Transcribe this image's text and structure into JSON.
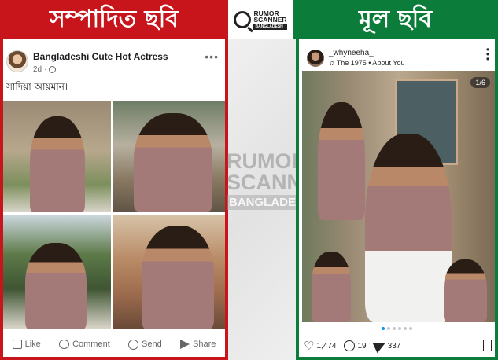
{
  "header": {
    "left_title": "সম্পাদিত ছবি",
    "right_title": "মূল ছবি",
    "logo_line1": "RUMOR",
    "logo_line2": "SCANNER",
    "logo_line3": "BANGLADESH"
  },
  "watermark": {
    "line1": "RUMOR",
    "line2": "SCANNER",
    "line3": "BANGLADESH"
  },
  "facebook_post": {
    "page_name": "Bangladeshi Cute Hot Actress",
    "time": "2d",
    "visibility_icon": "globe-icon",
    "caption": "সাদিয়া আয়মান।",
    "more_icon": "more-options-icon",
    "actions": [
      {
        "label": "Like",
        "icon": "like-icon"
      },
      {
        "label": "Comment",
        "icon": "comment-icon"
      },
      {
        "label": "Send",
        "icon": "send-icon"
      },
      {
        "label": "Share",
        "icon": "share-icon"
      }
    ]
  },
  "instagram_post": {
    "username": "_whyneeha_",
    "audio": "The 1975 • About You",
    "counter": "1/6",
    "likes": "1,474",
    "comments": "19",
    "shares": "337",
    "dots_total": 6,
    "dot_active": 1
  },
  "colors": {
    "edited_red": "#c8141b",
    "original_green": "#0c7c3a",
    "fb_text": "#1c1e21",
    "fb_meta": "#65676b",
    "ig_blue": "#0095f6"
  }
}
